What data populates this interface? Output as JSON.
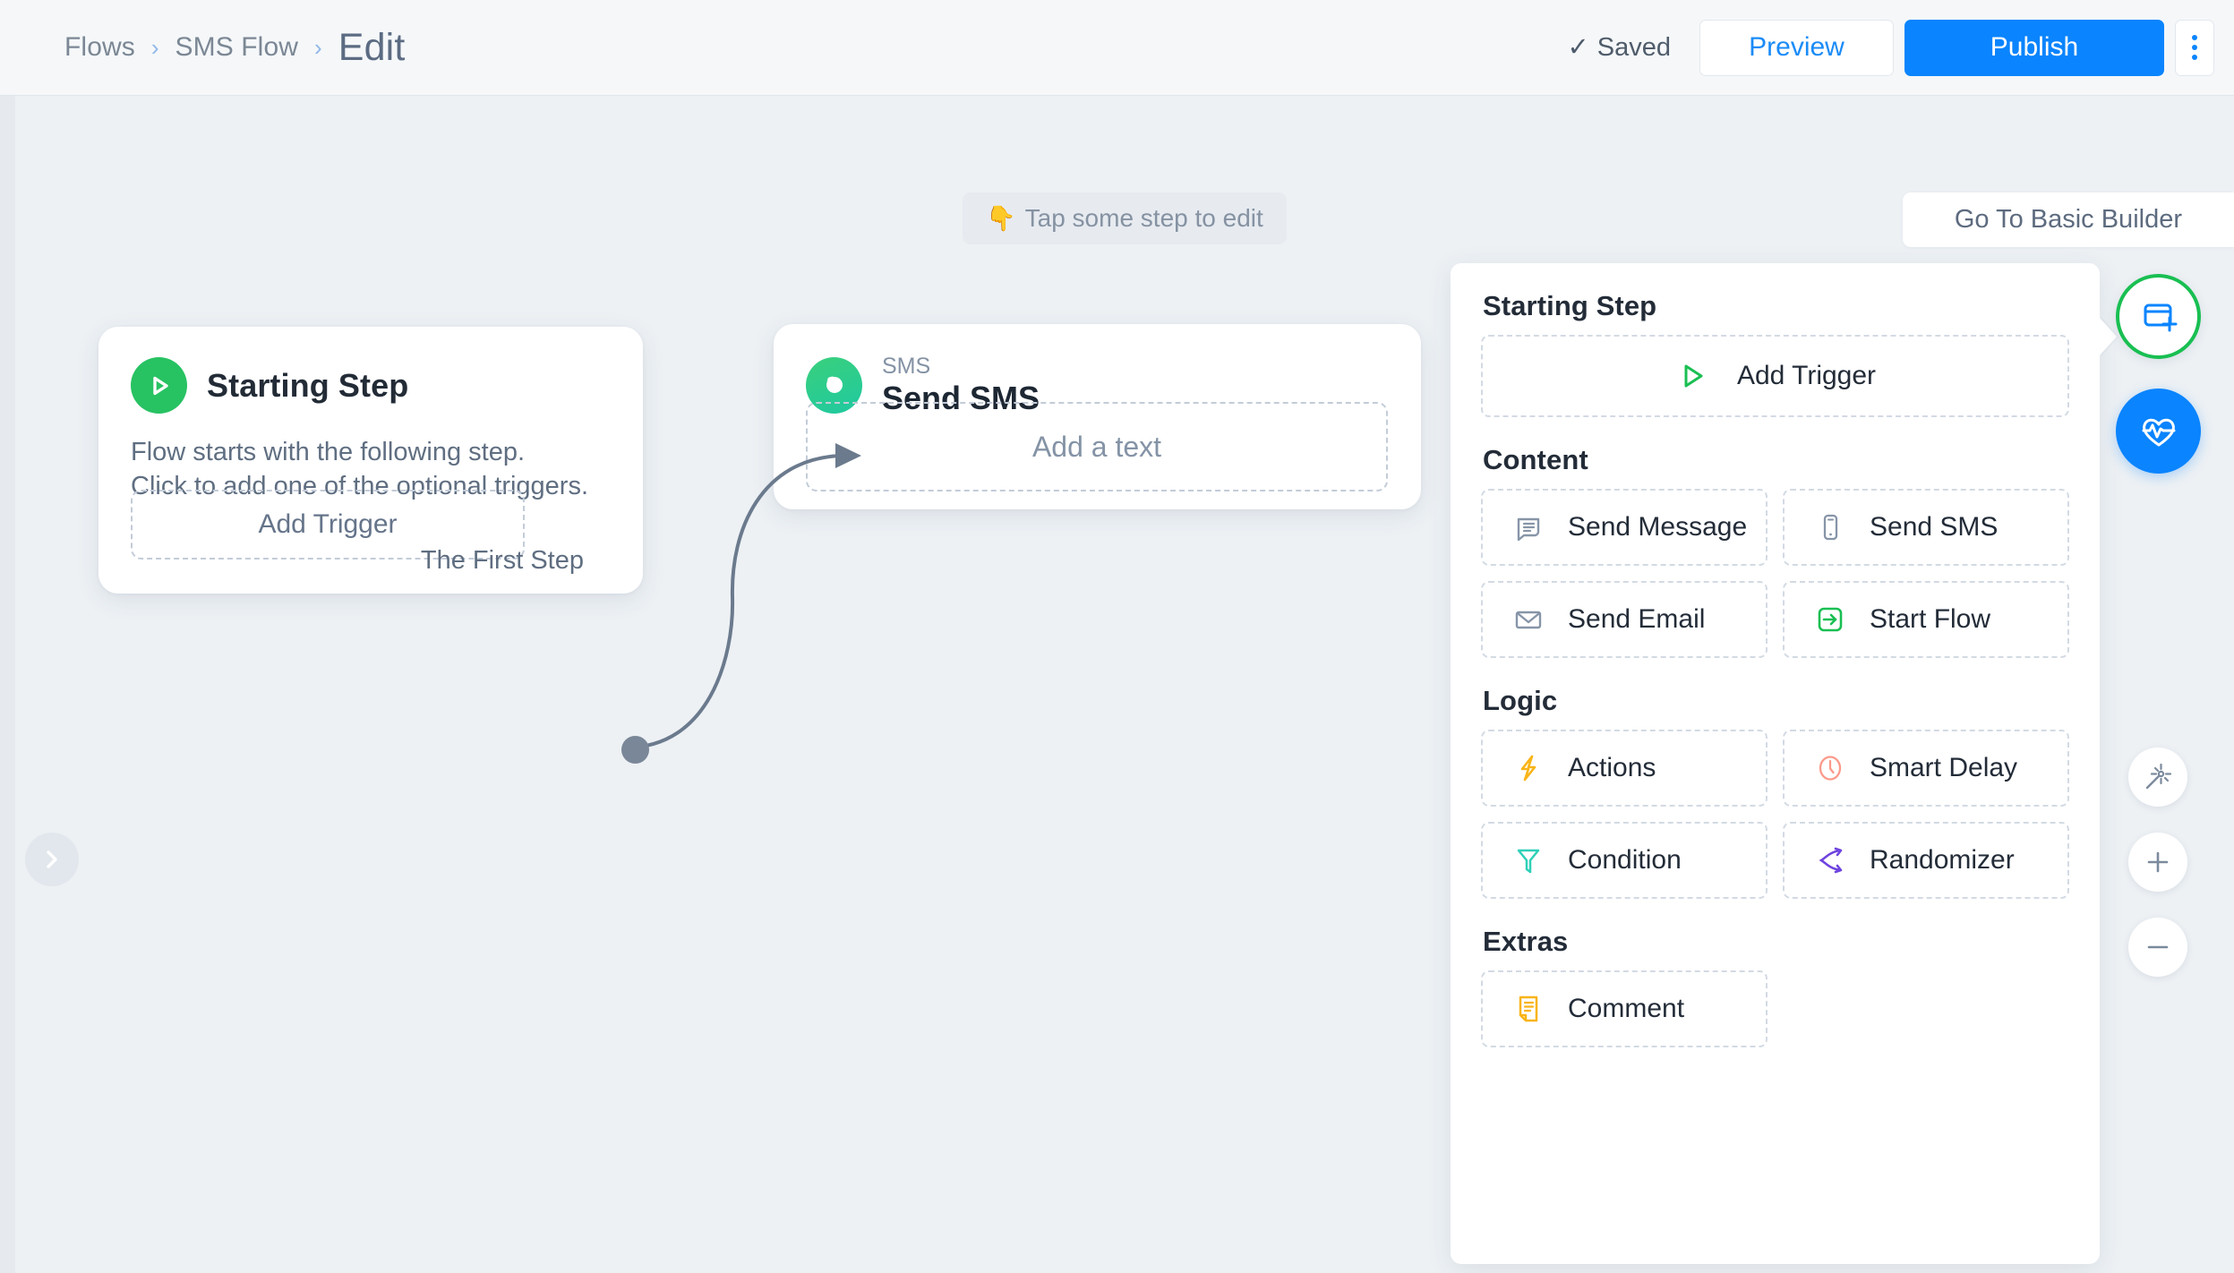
{
  "header": {
    "breadcrumb": [
      {
        "label": "Flows",
        "current": false
      },
      {
        "label": "SMS Flow",
        "current": false
      },
      {
        "label": "Edit",
        "current": true
      }
    ],
    "separator": "›",
    "saved_label": "Saved",
    "saved_check": "✓",
    "preview_label": "Preview",
    "publish_label": "Publish",
    "kebab_name": "more-options",
    "accent_blue": "#0a84ff"
  },
  "canvas": {
    "tip": {
      "emoji": "👇",
      "text": "Tap some step to edit"
    },
    "basic_builder_label": "Go To Basic Builder",
    "background": "#edf1f4"
  },
  "flow": {
    "starting_step": {
      "title": "Starting Step",
      "description_line1": "Flow starts with the following step.",
      "description_line2": "Click to add one of the optional triggers.",
      "add_trigger_label": "Add Trigger",
      "out_label": "The First Step",
      "icon_color": "#27c262"
    },
    "sms_step": {
      "eyebrow": "SMS",
      "title": "Send SMS",
      "placeholder_label": "Add a text",
      "icon_color": "#2bcb8c"
    }
  },
  "panel": {
    "sections": [
      {
        "title": "Starting Step",
        "layout": "wide",
        "items": [
          {
            "label": "Add Trigger",
            "icon": "play-outline-icon",
            "color": "#19bf52"
          }
        ]
      },
      {
        "title": "Content",
        "layout": "grid",
        "items": [
          {
            "label": "Send Message",
            "icon": "chat-lines-icon",
            "color": "#8795a8"
          },
          {
            "label": "Send SMS",
            "icon": "phone-icon",
            "color": "#8795a8"
          },
          {
            "label": "Send Email",
            "icon": "envelope-icon",
            "color": "#8795a8"
          },
          {
            "label": "Start Flow",
            "icon": "arrow-into-box-icon",
            "color": "#19bf52"
          }
        ]
      },
      {
        "title": "Logic",
        "layout": "grid",
        "items": [
          {
            "label": "Actions",
            "icon": "lightning-bolt-icon",
            "color": "#f9b417"
          },
          {
            "label": "Smart Delay",
            "icon": "clock-icon",
            "color": "#fb9a8a"
          },
          {
            "label": "Condition",
            "icon": "funnel-icon",
            "color": "#2fd0b8"
          },
          {
            "label": "Randomizer",
            "icon": "branch-icon",
            "color": "#6f44e0"
          }
        ]
      },
      {
        "title": "Extras",
        "layout": "grid-single",
        "items": [
          {
            "label": "Comment",
            "icon": "note-icon",
            "color": "#f9b417"
          }
        ]
      }
    ]
  },
  "controls": {
    "add_step": {
      "name": "add-step-button",
      "icon": "window-plus-icon",
      "ring_color": "#19bf52"
    },
    "health": {
      "name": "flow-health-button",
      "icon": "heartbeat-icon",
      "color": "#0a84ff"
    },
    "auto_arrange": {
      "name": "auto-arrange-button",
      "icon": "magic-wand-icon"
    },
    "zoom_in": {
      "name": "zoom-in-button",
      "icon": "plus-icon"
    },
    "zoom_out": {
      "name": "zoom-out-button",
      "icon": "minus-icon"
    },
    "collapse": {
      "name": "expand-sidebar-button",
      "icon": "chevron-right-icon"
    }
  }
}
